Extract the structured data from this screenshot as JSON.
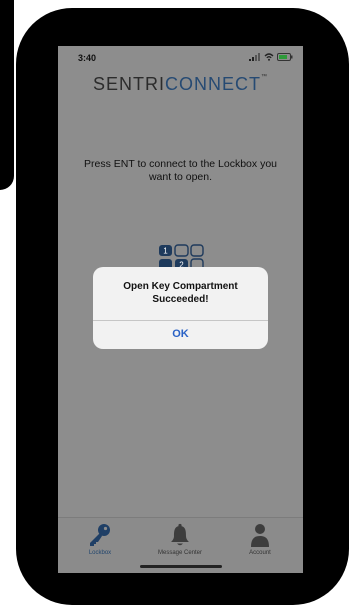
{
  "status_bar": {
    "time": "3:40"
  },
  "header": {
    "brand_part1": "SENTRI",
    "brand_part2": "CONNECT",
    "trademark": "™"
  },
  "main": {
    "instruction": "Press ENT to connect to the Lockbox you want to open."
  },
  "keypad": {
    "digit_1": "1",
    "digit_2": "2"
  },
  "alert": {
    "message_line1": "Open Key Compartment",
    "message_line2": "Succeeded!",
    "ok_label": "OK"
  },
  "tabbar": {
    "items": [
      {
        "label": "Lockbox",
        "icon": "key-icon",
        "active": true
      },
      {
        "label": "Message Center",
        "icon": "bell-icon",
        "active": false
      },
      {
        "label": "Account",
        "icon": "person-icon",
        "active": false
      }
    ]
  },
  "colors": {
    "overlay": "#8d8d8d",
    "brand_blue": "#264a73",
    "alert_button": "#2a62c6",
    "alert_bg": "#f2f2f2"
  }
}
